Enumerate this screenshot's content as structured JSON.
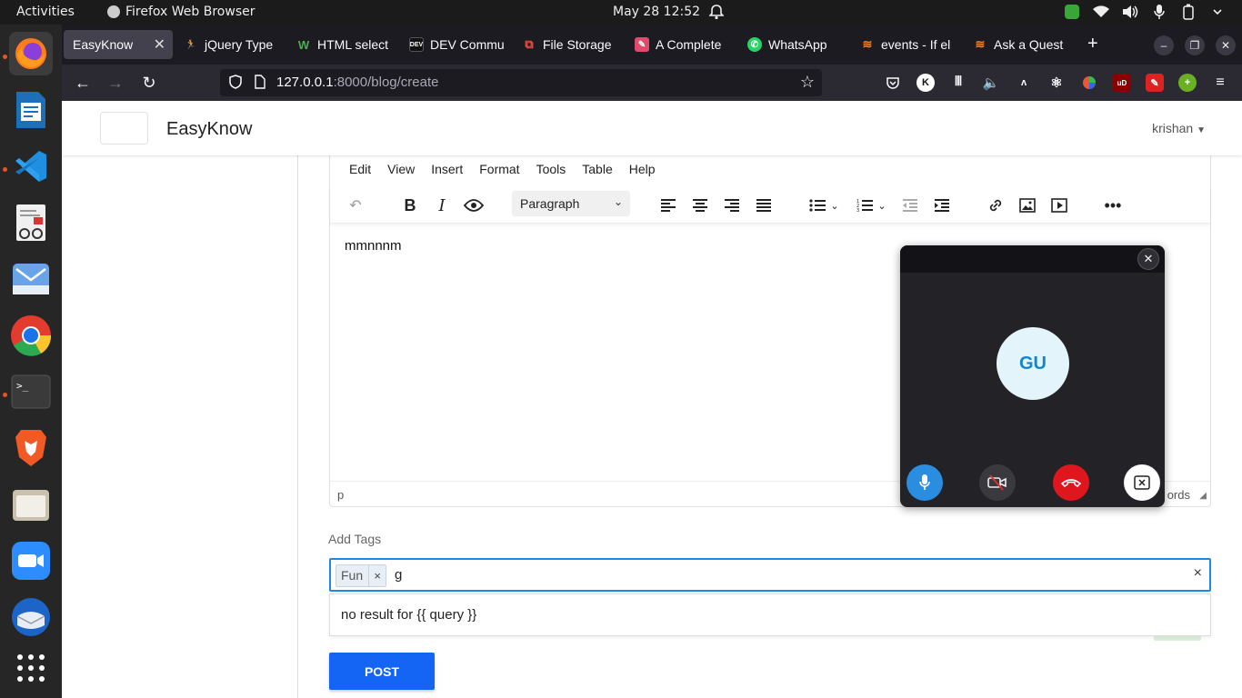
{
  "system": {
    "activities": "Activities",
    "app_name": "Firefox Web Browser",
    "clock": "May 28  12:52"
  },
  "tabs": [
    {
      "label": "EasyKnow",
      "active": true
    },
    {
      "label": "jQuery Type"
    },
    {
      "label": "HTML select"
    },
    {
      "label": "DEV Commu"
    },
    {
      "label": "File Storage"
    },
    {
      "label": "A Complete"
    },
    {
      "label": "WhatsApp"
    },
    {
      "label": "events - If el"
    },
    {
      "label": "Ask a Quest"
    }
  ],
  "urlbar": {
    "host": "127.0.0.1",
    "rest": ":8000/blog/create"
  },
  "site": {
    "brand": "EasyKnow",
    "user": "krishan"
  },
  "editor": {
    "menu": [
      "Edit",
      "View",
      "Insert",
      "Format",
      "Tools",
      "Table",
      "Help"
    ],
    "block_format": "Paragraph",
    "content": "mmnnnm",
    "status_path": "p",
    "status_words": "ords"
  },
  "tags": {
    "label": "Add Tags",
    "chips": [
      "Fun"
    ],
    "chip_remove": "×",
    "query": "g",
    "clear": "×",
    "dropdown": "no result for {{ query }}"
  },
  "post_label": "POST",
  "call": {
    "avatar_initials": "GU"
  },
  "colors": {
    "accent": "#1565f5",
    "focus": "#1e88e5",
    "end_call": "#e0161e",
    "mic": "#2b8de0"
  }
}
